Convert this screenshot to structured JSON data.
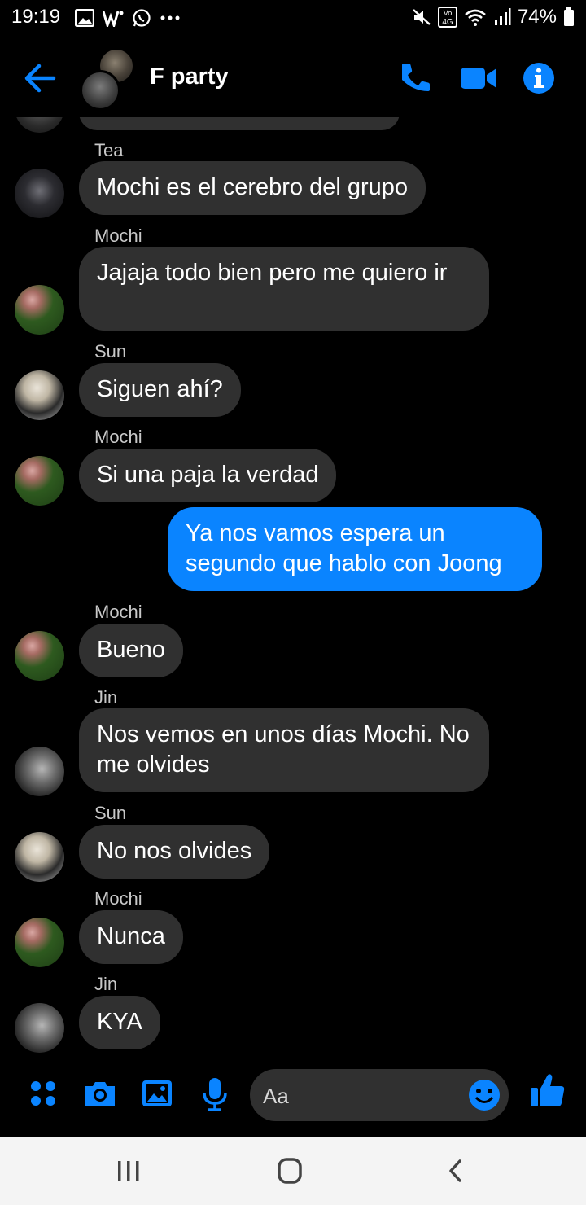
{
  "status_bar": {
    "time": "19:19",
    "battery": "74%",
    "icons_left": [
      "gallery-icon",
      "w-app-icon",
      "whatsapp-icon",
      "more-dots-icon"
    ],
    "icons_right": [
      "mute-icon",
      "volte-4g-icon",
      "wifi-icon",
      "signal-icon",
      "battery-icon"
    ]
  },
  "header": {
    "title": "F party",
    "actions": [
      "phone-icon",
      "video-call-icon",
      "info-icon"
    ]
  },
  "messages": [
    {
      "sender": "Tea",
      "text": "Mochi es el cerebro del grupo",
      "mine": false,
      "avatar": "Tea"
    },
    {
      "sender": "Mochi",
      "text": "Jajaja todo bien pero me quiero ir",
      "mine": false,
      "avatar": "Mochi"
    },
    {
      "sender": "Sun",
      "text": "Siguen ahí?",
      "mine": false,
      "avatar": "Sun"
    },
    {
      "sender": "Mochi",
      "text": "Si una paja la verdad",
      "mine": false,
      "avatar": "Mochi"
    },
    {
      "sender": "",
      "text": "Ya nos vamos espera un segundo que hablo con Joong",
      "mine": true
    },
    {
      "sender": "Mochi",
      "text": "Bueno",
      "mine": false,
      "avatar": "Mochi"
    },
    {
      "sender": "Jin",
      "text": "Nos vemos en unos días Mochi. No me olvides",
      "mine": false,
      "avatar": "Jin"
    },
    {
      "sender": "Sun",
      "text": "No nos olvides",
      "mine": false,
      "avatar": "Sun"
    },
    {
      "sender": "Mochi",
      "text": "Nunca",
      "mine": false,
      "avatar": "Mochi"
    },
    {
      "sender": "Jin",
      "text": "KYA",
      "mine": false,
      "avatar": "Jin"
    }
  ],
  "composer": {
    "placeholder": "Aa",
    "tools": [
      "apps-icon",
      "camera-icon",
      "image-icon",
      "mic-icon"
    ]
  },
  "colors": {
    "accent": "#0a84ff",
    "bubble_incoming": "#303030",
    "background": "#000000"
  }
}
